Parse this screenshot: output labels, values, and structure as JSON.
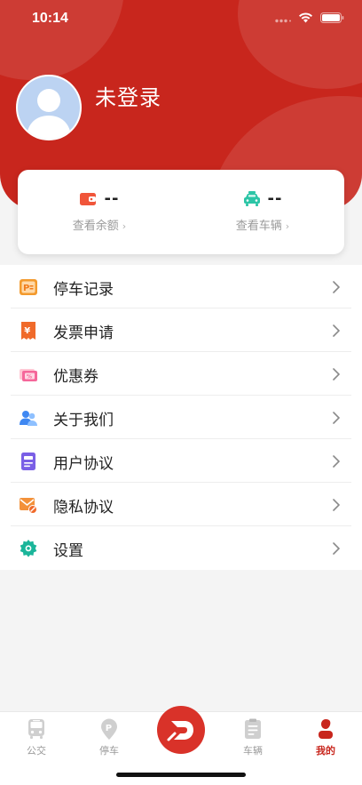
{
  "status_bar": {
    "time": "10:14"
  },
  "profile": {
    "title": "未登录",
    "avatar_icon": "user-avatar-icon"
  },
  "info_card": {
    "balance": {
      "value": "--",
      "link": "查看余额",
      "icon": "wallet-icon"
    },
    "vehicle": {
      "value": "--",
      "link": "查看车辆",
      "icon": "car-icon"
    }
  },
  "menu": {
    "items": [
      {
        "label": "停车记录",
        "icon": "parking-record-icon"
      },
      {
        "label": "发票申请",
        "icon": "invoice-icon"
      },
      {
        "label": "优惠券",
        "icon": "coupon-icon"
      },
      {
        "label": "关于我们",
        "icon": "about-us-icon"
      },
      {
        "label": "用户协议",
        "icon": "user-agreement-icon"
      },
      {
        "label": "隐私协议",
        "icon": "privacy-icon"
      },
      {
        "label": "设置",
        "icon": "settings-icon"
      }
    ]
  },
  "tab_bar": {
    "tabs": [
      {
        "label": "公交",
        "icon": "bus-icon",
        "active": false
      },
      {
        "label": "停车",
        "icon": "parking-icon",
        "active": false
      },
      {
        "label": "",
        "icon": "app-logo-icon",
        "active": false
      },
      {
        "label": "车辆",
        "icon": "clipboard-icon",
        "active": false
      },
      {
        "label": "我的",
        "icon": "person-icon",
        "active": true
      }
    ]
  },
  "colors": {
    "brand_red": "#c8261d",
    "tab_active": "#c8261d",
    "tab_inactive": "#999999",
    "wallet": "#f0553a",
    "car": "#2cc5a6"
  }
}
